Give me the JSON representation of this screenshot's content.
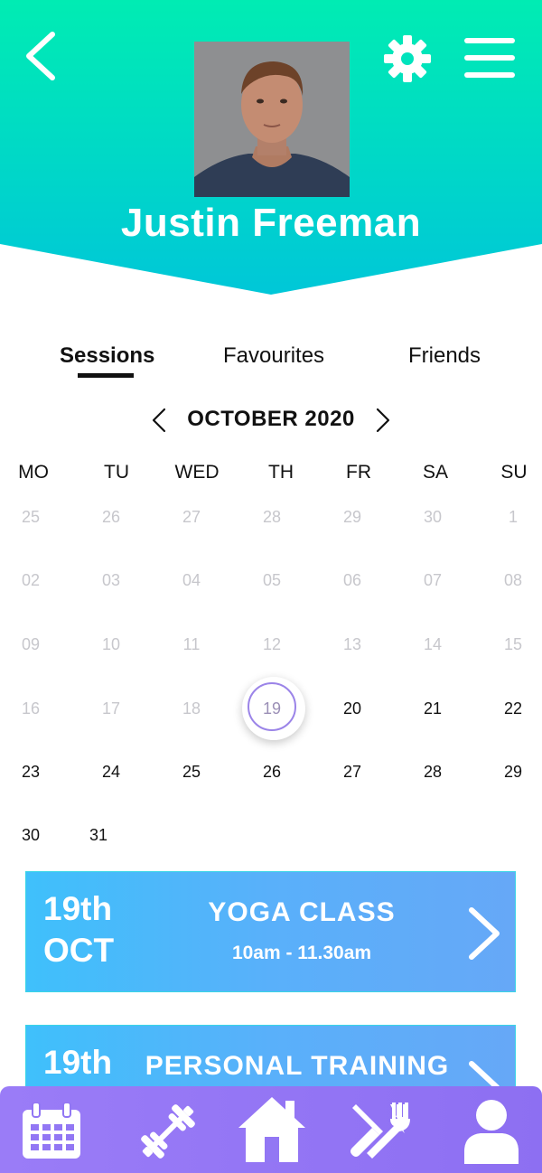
{
  "header": {
    "user_name": "Justin Freeman",
    "gradient_top": "#00ecb3",
    "gradient_bottom": "#00c7d8",
    "icons": [
      "back-arrow-icon",
      "gear-icon",
      "hamburger-menu-icon"
    ]
  },
  "tabs": [
    {
      "label": "Sessions",
      "active": true
    },
    {
      "label": "Favourites",
      "active": false
    },
    {
      "label": "Friends",
      "active": false
    }
  ],
  "calendar": {
    "month_label": "OCTOBER 2020",
    "weekdays": [
      "MO",
      "TU",
      "WED",
      "TH",
      "FR",
      "SA",
      "SU"
    ],
    "weeks": [
      [
        "25",
        "26",
        "27",
        "28",
        "29",
        "30",
        "1"
      ],
      [
        "02",
        "03",
        "04",
        "05",
        "06",
        "07",
        "08"
      ],
      [
        "09",
        "10",
        "11",
        "12",
        "13",
        "14",
        "15"
      ],
      [
        "16",
        "17",
        "18",
        "19",
        "20",
        "21",
        "22"
      ],
      [
        "23",
        "24",
        "25",
        "26",
        "27",
        "28",
        "29"
      ],
      [
        "30",
        "31"
      ]
    ],
    "selected_day": "19",
    "accent_color": "#9b84e8"
  },
  "sessions": [
    {
      "date_day": "19th",
      "date_month": "OCT",
      "title": "YOGA CLASS",
      "time": "10am - 11.30am"
    },
    {
      "date_day": "19th",
      "title": "PERSONAL TRAINING"
    }
  ],
  "bottom_nav": {
    "background": "#9577f5",
    "items": [
      "calendar-icon",
      "dumbbell-icon",
      "home-icon",
      "fork-knife-icon",
      "user-icon"
    ]
  }
}
